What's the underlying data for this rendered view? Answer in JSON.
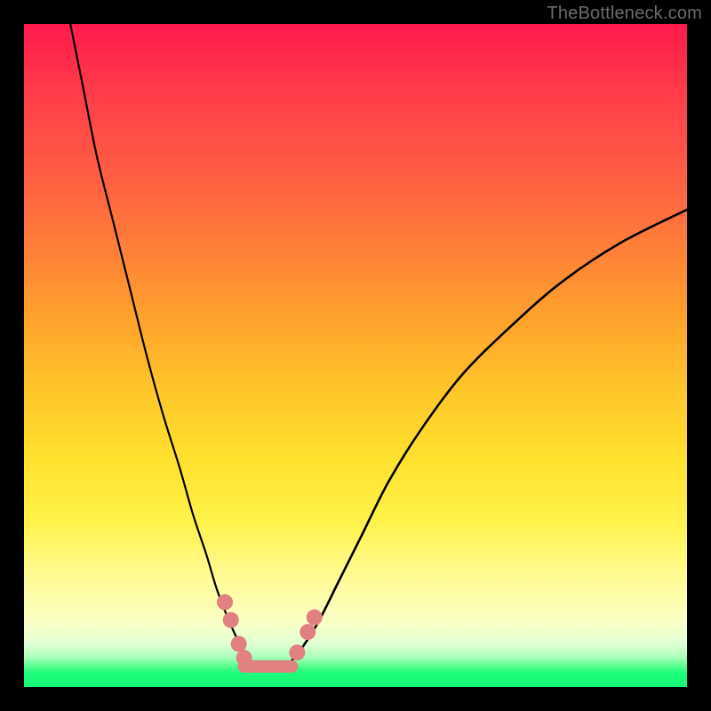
{
  "watermark": "TheBottleneck.com",
  "chart_data": {
    "type": "line",
    "title": "",
    "xlabel": "",
    "ylabel": "",
    "xlim": [
      0,
      100
    ],
    "ylim": [
      0,
      100
    ],
    "grid": false,
    "legend": false,
    "series": [
      {
        "name": "left-curve",
        "x": [
          7,
          9,
          11,
          13.5,
          16,
          18.5,
          21,
          23.5,
          25.5,
          27.5,
          29,
          30.5,
          31.8,
          33,
          34
        ],
        "y": [
          100,
          90,
          80,
          70,
          60,
          50,
          41,
          33,
          26,
          20,
          15,
          11,
          8,
          5.5,
          3.5
        ]
      },
      {
        "name": "right-curve",
        "x": [
          40,
          42,
          44.5,
          47.5,
          51,
          55,
          60,
          66,
          73,
          81,
          90,
          100
        ],
        "y": [
          3.5,
          6,
          10,
          16,
          23,
          31,
          39,
          47,
          54,
          61,
          67,
          72
        ]
      },
      {
        "name": "flat-bottom",
        "x": [
          34,
          40
        ],
        "y": [
          3.5,
          3.5
        ]
      }
    ],
    "markers": {
      "name": "highlight-markers",
      "color": "#e08080",
      "points": [
        {
          "x": 30.3,
          "y": 12.8
        },
        {
          "x": 31.2,
          "y": 10.1
        },
        {
          "x": 32.4,
          "y": 6.5
        },
        {
          "x": 33.2,
          "y": 4.4
        },
        {
          "x": 41.2,
          "y": 5.2
        },
        {
          "x": 42.8,
          "y": 8.3
        },
        {
          "x": 43.8,
          "y": 10.5
        }
      ],
      "segment": {
        "x0": 33.2,
        "y0": 3.1,
        "x1": 40.4,
        "y1": 3.1
      }
    },
    "background_gradient": {
      "orientation": "vertical",
      "stops": [
        {
          "pos": 0.0,
          "color": "#ff1a4d"
        },
        {
          "pos": 0.28,
          "color": "#ff6d3f"
        },
        {
          "pos": 0.55,
          "color": "#ffc529"
        },
        {
          "pos": 0.75,
          "color": "#fff24a"
        },
        {
          "pos": 0.9,
          "color": "#fcffc5"
        },
        {
          "pos": 0.97,
          "color": "#4eff8c"
        },
        {
          "pos": 1.0,
          "color": "#17f877"
        }
      ]
    }
  }
}
